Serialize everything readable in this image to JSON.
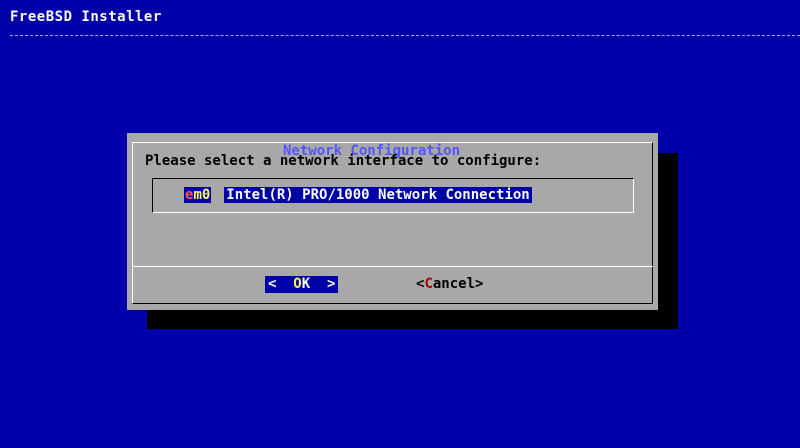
{
  "app": {
    "title": "FreeBSD Installer"
  },
  "dialog": {
    "title": "Network Configuration",
    "prompt": "Please select a network interface to configure:",
    "menu": [
      {
        "tag_hot": "e",
        "tag_rest": "m0",
        "description": "Intel(R) PRO/1000 Network Connection",
        "selected": true
      }
    ],
    "buttons": {
      "ok": {
        "left": "<",
        "hot": "O",
        "rest": "K",
        "right": ">"
      },
      "cancel": {
        "left": "<",
        "hot": "C",
        "rest": "ancel",
        "right": ">"
      }
    }
  },
  "colors": {
    "background": "#0000a8",
    "dialog": "#a8a8a8",
    "dialog_title": "#5454fc",
    "highlight": "#0000a8",
    "hotkey": "#fcfc54",
    "hotkey_inactive": "#a80000"
  }
}
